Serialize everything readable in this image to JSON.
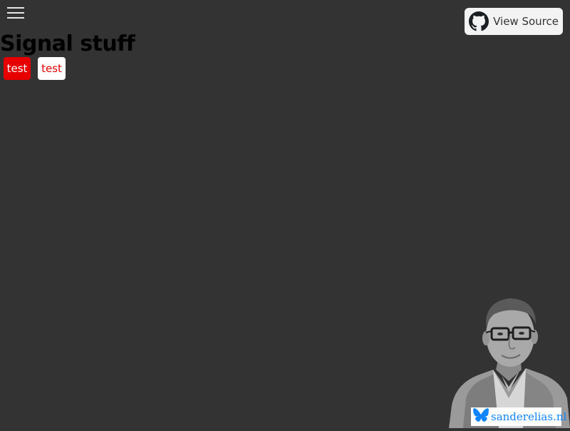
{
  "header": {
    "menu_icon": "hamburger-menu-icon",
    "view_source": {
      "label": "View Source",
      "icon": "github-icon"
    }
  },
  "main": {
    "title": "Signal stuff",
    "buttons": [
      {
        "label": "test",
        "style": "filled",
        "bg": "#e60000",
        "fg": "#ffffff"
      },
      {
        "label": "test",
        "style": "outline",
        "bg": "#ffffff",
        "fg": "#e60000"
      }
    ]
  },
  "footer": {
    "avatar": "author-portrait",
    "badge": {
      "label": "sanderelias.nl",
      "icon": "bluesky-butterfly-icon",
      "color": "#1185fe"
    }
  },
  "colors": {
    "background": "#333333",
    "accent": "#e60000"
  }
}
